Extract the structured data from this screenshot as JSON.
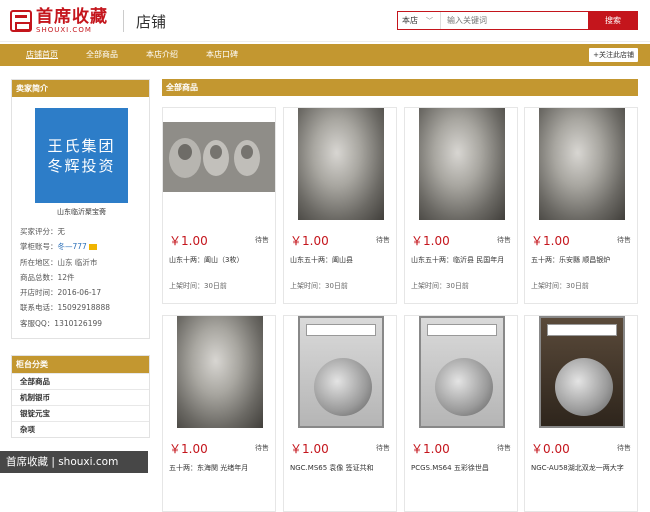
{
  "header": {
    "logo_cn": "首席收藏",
    "logo_en": "SHOUXI.COM",
    "shop_label": "店铺",
    "search_scope": "本店",
    "search_placeholder": "输入关键词",
    "search_button": "搜索"
  },
  "nav": {
    "items": [
      "店铺首页",
      "全部商品",
      "本店介绍",
      "本店口碑"
    ],
    "follow": "+关注此店铺"
  },
  "sidebar": {
    "profile_title": "卖家简介",
    "shop_image_lines": [
      "王氏集团",
      "冬辉投资"
    ],
    "shop_name": "山东临沂聚宝斋",
    "info": {
      "rating": "买家评分：无",
      "account_label": "掌柜账号：",
      "account_value": "冬—777",
      "location": "所在地区：山东 临沂市",
      "product_count": "商品总数：12件",
      "open_date": "开店时间：2016-06-17",
      "phone": "联系电话：15092918888",
      "qq": "客服QQ：1310126199"
    },
    "category_title": "柜台分类",
    "categories": [
      "全部商品",
      "机制银币",
      "银锭元宝",
      "杂项"
    ]
  },
  "main": {
    "section_title": "全部商品",
    "products": [
      {
        "price": "￥1.00",
        "status": "待售",
        "title": "山东十两：阖山（3枚）",
        "date": "上架时间：30日前"
      },
      {
        "price": "￥1.00",
        "status": "待售",
        "title": "山东五十两：阖山县",
        "date": "上架时间：30日前"
      },
      {
        "price": "￥1.00",
        "status": "待售",
        "title": "山东五十两：临沂县 民国年月",
        "date": "上架时间：30日前"
      },
      {
        "price": "￥1.00",
        "status": "待售",
        "title": "五十两：乐安縣 顺昌银炉",
        "date": "上架时间：30日前"
      },
      {
        "price": "￥1.00",
        "status": "待售",
        "title": "五十两：东海関 光绪年月",
        "date": ""
      },
      {
        "price": "￥1.00",
        "status": "待售",
        "title": "NGC.MS65 袁像 签证共和",
        "date": ""
      },
      {
        "price": "￥1.00",
        "status": "待售",
        "title": "PCGS.MS64 五彩徐世昌",
        "date": ""
      },
      {
        "price": "￥0.00",
        "status": "待售",
        "title": "NGC-AU58湖北双龙一两大字",
        "date": ""
      }
    ]
  },
  "watermark": "首席收藏 | shouxi.com",
  "colors": {
    "brand_red": "#c4151c",
    "gold_bar": "#c39730",
    "link_blue": "#2b6fb8"
  }
}
